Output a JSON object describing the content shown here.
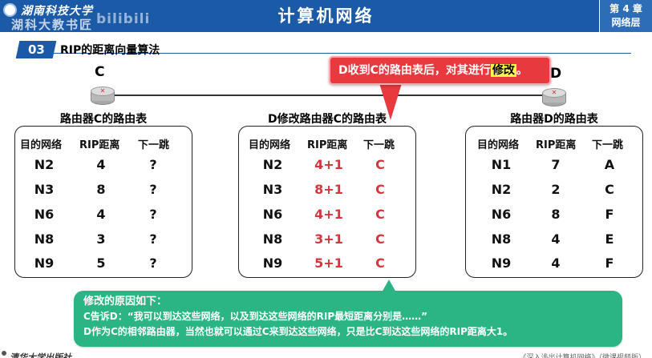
{
  "header": {
    "university": "湖南科技大学",
    "watermark": "湖科大教书匠",
    "bilibili": "bilibili",
    "title": "计算机网络",
    "chapter_line1": "第 4 章",
    "chapter_line2": "网络层"
  },
  "section": {
    "number": "03",
    "title": "RIP的距离向量算法"
  },
  "routers": {
    "left_label": "C",
    "right_label": "D"
  },
  "callout": {
    "text_prefix": "D收到C的路由表后，对其进行",
    "highlight": "修改",
    "text_suffix": "。"
  },
  "tables": [
    {
      "title": "路由器C的路由表",
      "headers": [
        "目的网络",
        "RIP距离",
        "下一跳"
      ],
      "rows": [
        [
          "N2",
          "4",
          "?"
        ],
        [
          "N3",
          "8",
          "?"
        ],
        [
          "N6",
          "4",
          "?"
        ],
        [
          "N8",
          "3",
          "?"
        ],
        [
          "N9",
          "5",
          "?"
        ]
      ]
    },
    {
      "title": "D修改路由器C的路由表",
      "headers": [
        "目的网络",
        "RIP距离",
        "下一跳"
      ],
      "rows": [
        [
          "N2",
          "4+1",
          "C"
        ],
        [
          "N3",
          "8+1",
          "C"
        ],
        [
          "N6",
          "4+1",
          "C"
        ],
        [
          "N8",
          "3+1",
          "C"
        ],
        [
          "N9",
          "5+1",
          "C"
        ]
      ]
    },
    {
      "title": "路由器D的路由表",
      "headers": [
        "目的网络",
        "RIP距离",
        "下一跳"
      ],
      "rows": [
        [
          "N1",
          "7",
          "A"
        ],
        [
          "N2",
          "2",
          "C"
        ],
        [
          "N6",
          "8",
          "F"
        ],
        [
          "N8",
          "4",
          "E"
        ],
        [
          "N9",
          "4",
          "F"
        ]
      ]
    }
  ],
  "note": {
    "line1": "修改的原因如下：",
    "line2": "C告诉D：“我可以到达这些网络，以及到达这些网络的RIP最短距离分别是……”",
    "line3": "D作为C的相邻路由器，当然也就可以通过C来到达这些网络，只是比C到达这些网络的RIP距离大1。"
  },
  "footer": {
    "publisher": "清华大学出版社",
    "right_text": "《深入浅出计算机网络》（微课视频版）"
  },
  "colors": {
    "brand_blue": "#1a5aa6",
    "callout_red": "#e8393f",
    "note_green": "#2bb584",
    "modified_red": "#d8343c"
  }
}
